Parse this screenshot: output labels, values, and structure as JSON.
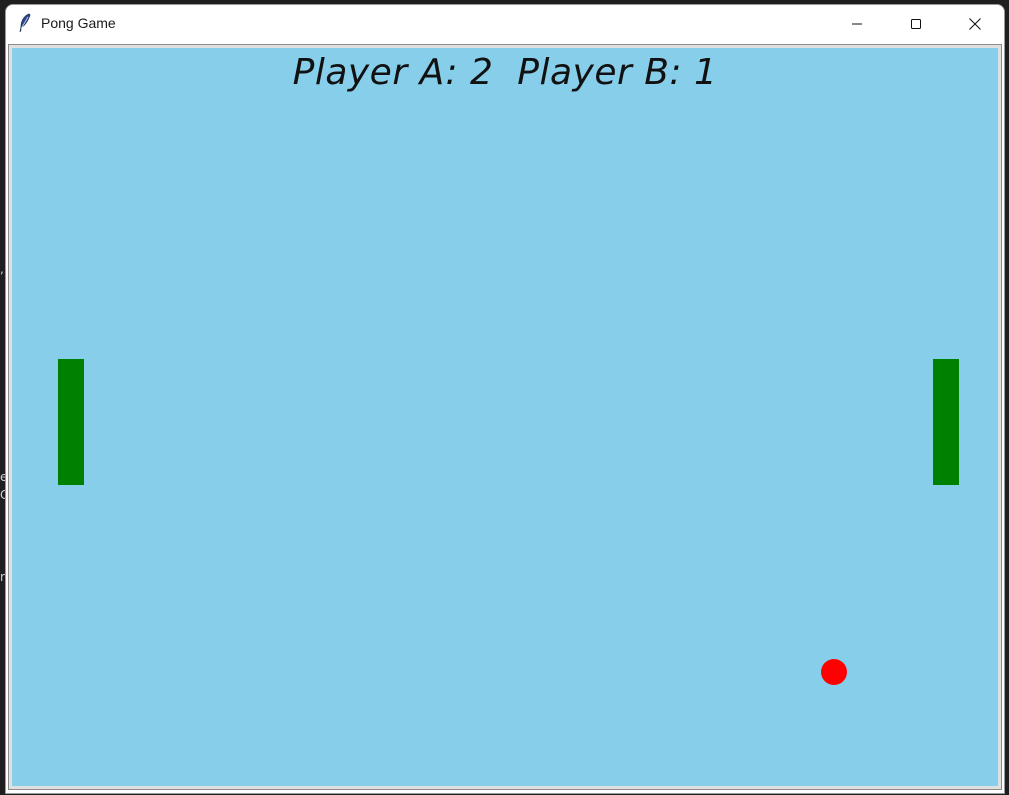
{
  "window": {
    "title": "Pong Game",
    "icon": "feather-icon",
    "controls": {
      "minimize": "minimize-icon",
      "maximize": "maximize-icon",
      "close": "close-icon"
    }
  },
  "game": {
    "score_text": "Player A: 2  Player B: 1",
    "colors": {
      "background": "#87ceeb",
      "paddle": "#008000",
      "ball": "#ff0000",
      "text": "#111111"
    }
  },
  "background_glyphs": [
    ",",
    "e",
    "C",
    "r"
  ]
}
